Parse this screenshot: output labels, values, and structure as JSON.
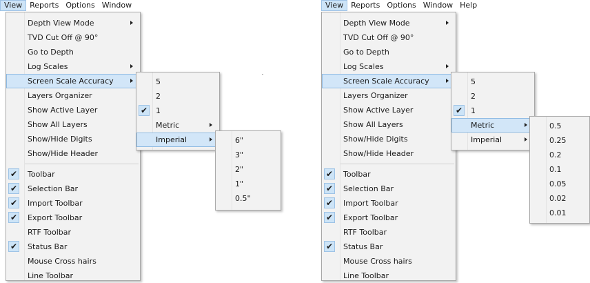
{
  "menubar": {
    "view": "View",
    "reports": "Reports",
    "options": "Options",
    "window": "Window",
    "help": "Help"
  },
  "view_menu": {
    "depth_view_mode": "Depth View Mode",
    "tvd_cut_off": "TVD Cut Off @ 90°",
    "go_to_depth": "Go to Depth",
    "log_scales": "Log Scales",
    "screen_scale_accuracy": "Screen Scale Accuracy",
    "layers_organizer": "Layers Organizer",
    "show_active_layer": "Show Active Layer",
    "show_all_layers": "Show All Layers",
    "show_hide_digits": "Show/Hide Digits",
    "show_hide_header": "Show/Hide Header",
    "toolbar": "Toolbar",
    "selection_bar": "Selection Bar",
    "import_toolbar": "Import Toolbar",
    "export_toolbar": "Export Toolbar",
    "rtf_toolbar": "RTF Toolbar",
    "status_bar": "Status Bar",
    "mouse_cross_hairs": "Mouse Cross hairs",
    "line_toolbar": "Line Toolbar"
  },
  "accuracy_menu": {
    "v5": "5",
    "v2": "2",
    "v1": "1",
    "metric": "Metric",
    "imperial": "Imperial"
  },
  "imperial_menu": [
    "6\"",
    "3\"",
    "2\"",
    "1\"",
    "0.5\""
  ],
  "metric_menu": [
    "0.5",
    "0.25",
    "0.2",
    "0.1",
    "0.05",
    "0.02",
    "0.01"
  ],
  "check_glyph": "✔"
}
